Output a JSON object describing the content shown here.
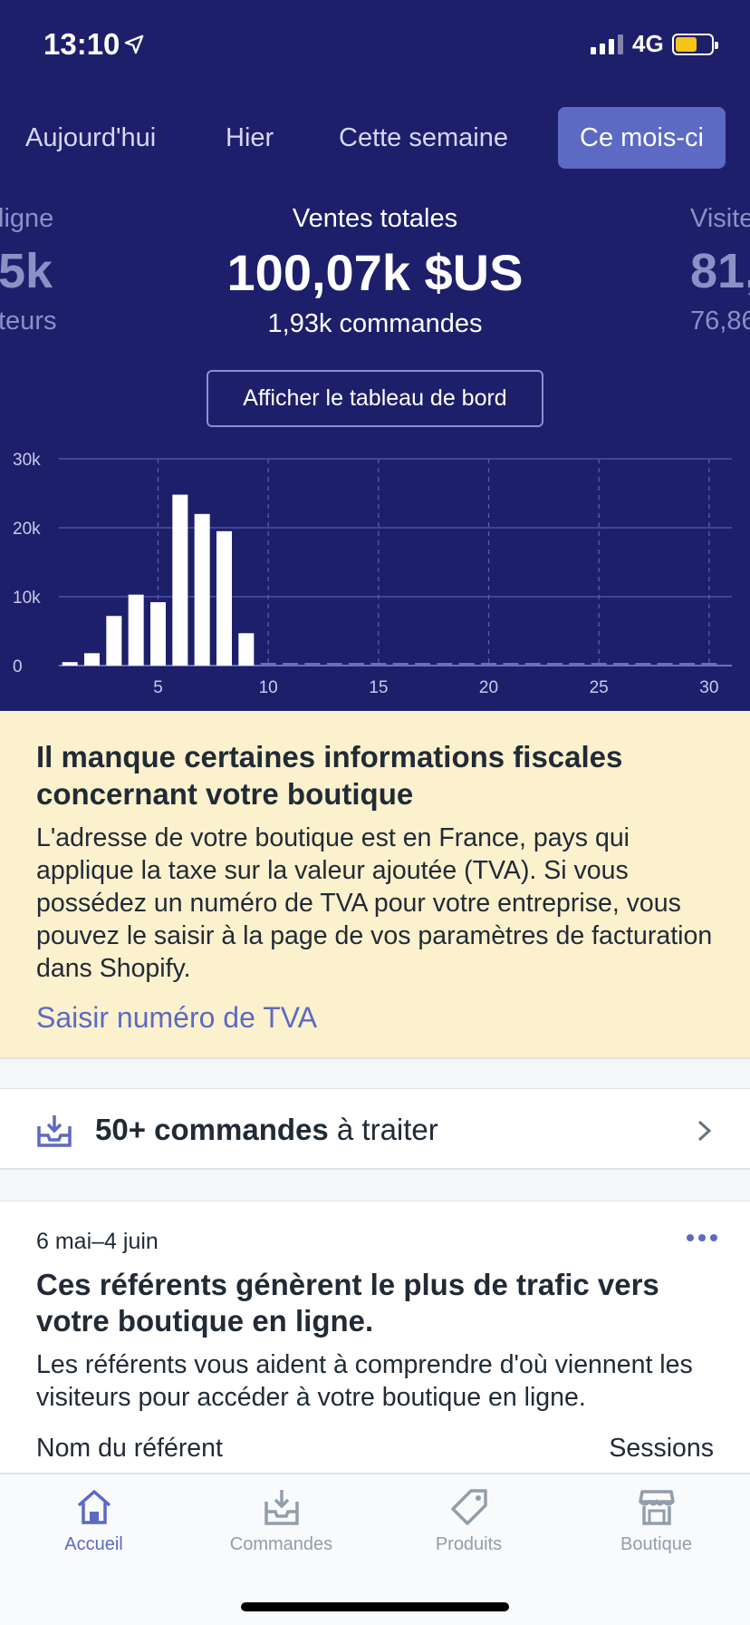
{
  "status": {
    "time": "13:10",
    "network": "4G"
  },
  "tabs": [
    {
      "label": "Aujourd'hui"
    },
    {
      "label": "Hier"
    },
    {
      "label": "Cette semaine"
    },
    {
      "label": "Ce mois-ci"
    }
  ],
  "metrics": {
    "left": {
      "label": "ligne",
      "value": "5k",
      "sub": "teurs"
    },
    "main": {
      "label": "Ventes totales",
      "value": "100,07k $US",
      "sub": "1,93k commandes"
    },
    "right": {
      "label": "Visite",
      "value": "81,",
      "sub": "76,86"
    }
  },
  "dashboard_button": "Afficher le tableau de bord",
  "chart_data": {
    "type": "bar",
    "x": [
      1,
      2,
      3,
      4,
      5,
      6,
      7,
      8,
      9,
      10,
      11,
      12,
      13,
      14,
      15,
      16,
      17,
      18,
      19,
      20,
      21,
      22,
      23,
      24,
      25,
      26,
      27,
      28,
      29,
      30
    ],
    "values": [
      500,
      1800,
      7200,
      10300,
      9200,
      24800,
      22000,
      19500,
      4700,
      0,
      0,
      0,
      0,
      0,
      0,
      0,
      0,
      0,
      0,
      0,
      0,
      0,
      0,
      0,
      0,
      0,
      0,
      0,
      0,
      0
    ],
    "ylim": [
      0,
      30000
    ],
    "y_ticks": [
      0,
      10000,
      20000,
      30000
    ],
    "y_tick_labels": [
      "0",
      "10k",
      "20k",
      "30k"
    ],
    "x_ticks": [
      5,
      10,
      15,
      20,
      25,
      30
    ],
    "x_tick_labels": [
      "5",
      "10",
      "15",
      "20",
      "25",
      "30"
    ],
    "bar_color": "#ffffff",
    "grid": true
  },
  "notice": {
    "title": "Il manque certaines informations fiscales concernant votre boutique",
    "body": "L'adresse de votre boutique est en France, pays qui applique la taxe sur la valeur ajoutée (TVA). Si vous possédez un numéro de TVA pour votre entreprise, vous pouvez le saisir à la page de vos paramètres de facturation dans Shopify.",
    "link": "Saisir numéro de TVA"
  },
  "orders": {
    "count": "50+ commandes",
    "rest": " à traiter"
  },
  "referrers": {
    "date": "6 mai–4 juin",
    "title": "Ces référents génèrent le plus de trafic vers votre boutique en ligne.",
    "body": "Les référents vous aident à comprendre d'où viennent les visiteurs pour accéder à votre boutique en ligne.",
    "col_name": "Nom du référent",
    "col_sessions": "Sessions"
  },
  "tabbar": [
    {
      "label": "Accueil",
      "icon": "home-icon"
    },
    {
      "label": "Commandes",
      "icon": "orders-icon"
    },
    {
      "label": "Produits",
      "icon": "tag-icon"
    },
    {
      "label": "Boutique",
      "icon": "store-icon"
    }
  ],
  "colors": {
    "hero_bg": "#1e1f6b",
    "accent": "#5c6ac4",
    "notice_bg": "#fcf1cd"
  }
}
